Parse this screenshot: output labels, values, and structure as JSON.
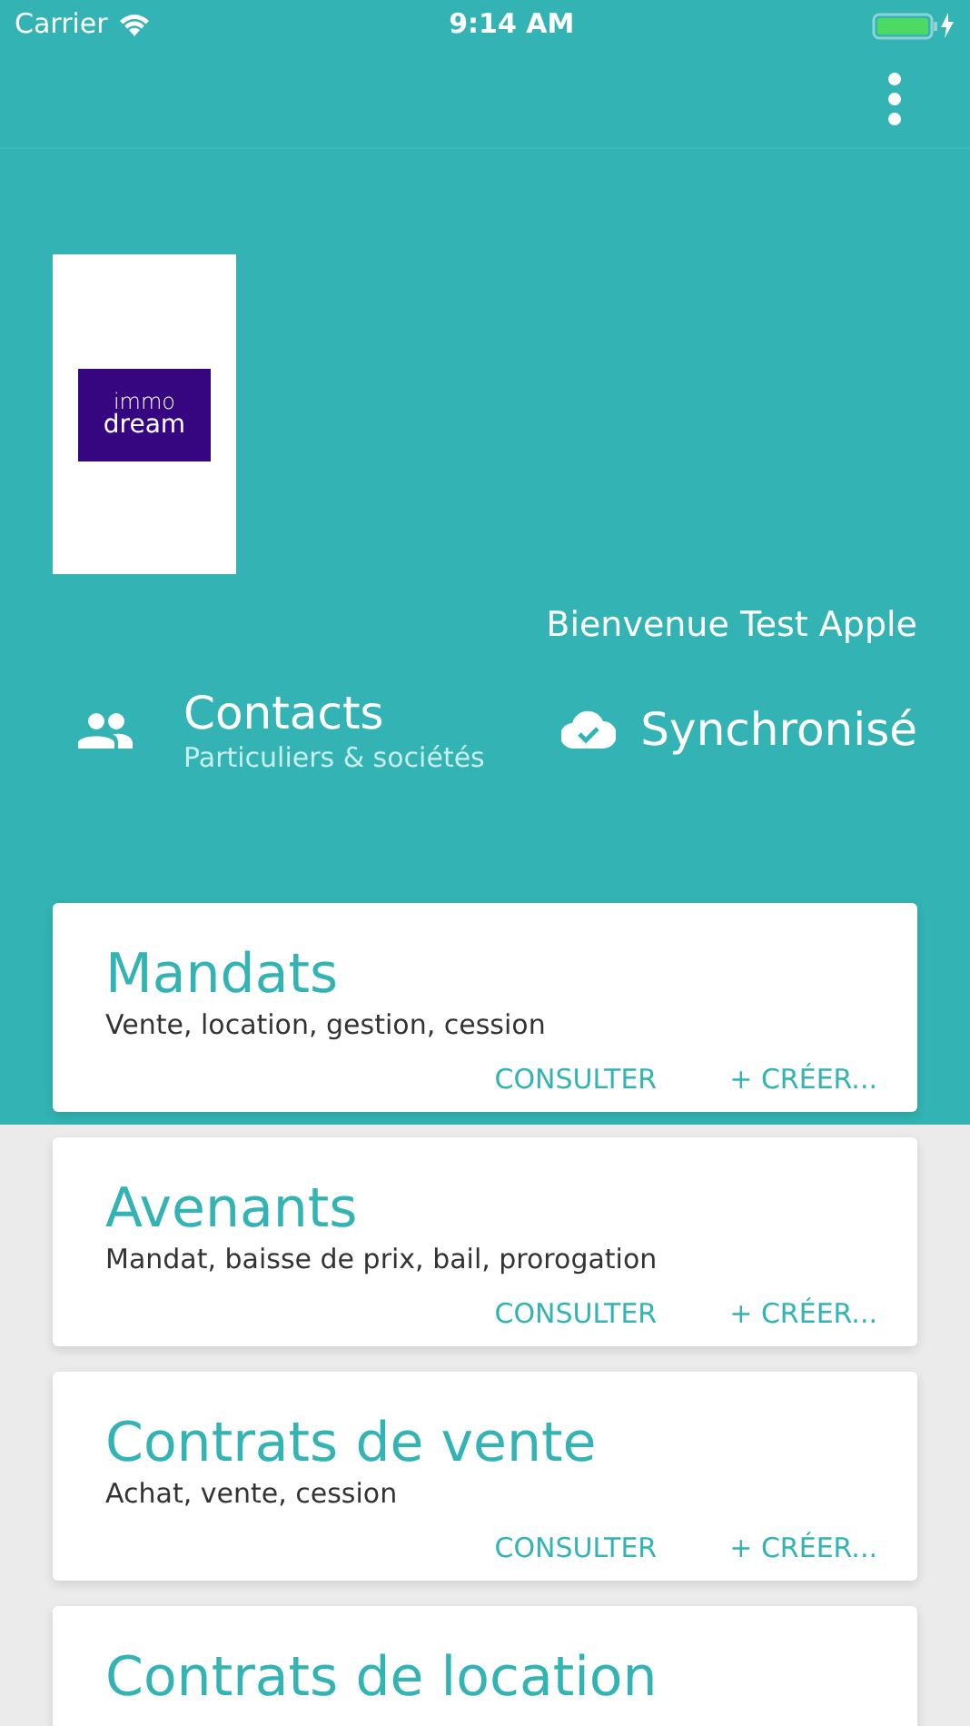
{
  "status_bar": {
    "carrier": "Carrier",
    "time": "9:14 AM"
  },
  "logo": {
    "line_1": "immo",
    "line_2": "dream"
  },
  "welcome": "Bienvenue Test Apple",
  "contacts": {
    "title": "Contacts",
    "subtitle": "Particuliers & sociétés"
  },
  "sync": {
    "label": "Synchronisé"
  },
  "cards": [
    {
      "title": "Mandats",
      "subtitle": "Vente, location, gestion, cession",
      "actions": [
        "CONSULTER",
        "+ CRÉER..."
      ]
    },
    {
      "title": "Avenants",
      "subtitle": "Mandat, baisse de prix, bail, prorogation",
      "actions": [
        "CONSULTER",
        "+ CRÉER..."
      ]
    },
    {
      "title": "Contrats de vente",
      "subtitle": "Achat, vente, cession",
      "actions": [
        "CONSULTER",
        "+ CRÉER..."
      ]
    },
    {
      "title": "Contrats de location"
    }
  ]
}
